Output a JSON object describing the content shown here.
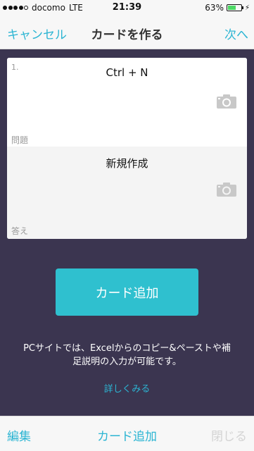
{
  "status_bar": {
    "carrier": "docomo",
    "network": "LTE",
    "time": "21:39",
    "battery": "63%",
    "battery_level": 0.63,
    "signal_bars_filled": 4,
    "signal_bars_total": 5
  },
  "nav": {
    "cancel_label": "キャンセル",
    "title": "カードを作る",
    "next_label": "次へ"
  },
  "card": {
    "number": "1.",
    "question_text": "Ctrl + N",
    "question_label": "問題",
    "answer_text": "新規作成",
    "answer_label": "答え"
  },
  "add_button_label": "カード追加",
  "info_line1": "PCサイトでは、Excelからのコピー&ペーストや補",
  "info_line2": "足説明の入力が可能です。",
  "more_link": "詳しくみる",
  "toolbar": {
    "edit_label": "編集",
    "add_label": "カード追加",
    "close_label": "閉じる"
  },
  "colors": {
    "accent": "#2cb5d3",
    "button": "#2fc0cf",
    "background": "#3b3550"
  },
  "icons": [
    "camera-icon",
    "battery-icon",
    "charging-icon"
  ]
}
